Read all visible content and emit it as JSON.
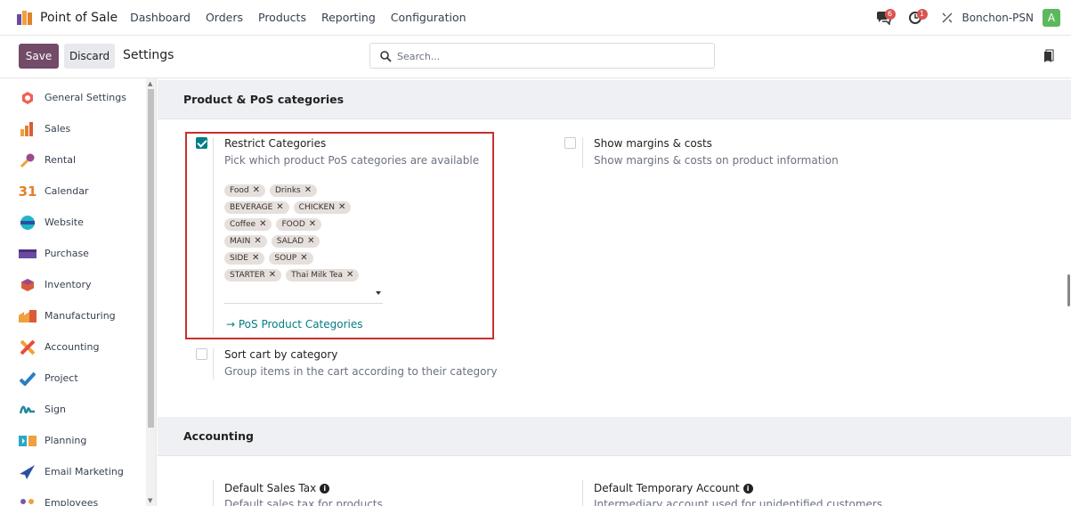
{
  "navbar": {
    "app_title": "Point of Sale",
    "menu": [
      "Dashboard",
      "Orders",
      "Products",
      "Reporting",
      "Configuration"
    ],
    "messages_count": "6",
    "activities_count": "1",
    "company": "Bonchon-PSN",
    "avatar_letter": "A"
  },
  "control": {
    "save_label": "Save",
    "discard_label": "Discard",
    "title": "Settings",
    "search_placeholder": "Search..."
  },
  "sidebar": {
    "items": [
      {
        "label": "General Settings",
        "icon": "gear-hex-icon",
        "color": "#f06050"
      },
      {
        "label": "Sales",
        "icon": "sales-icon",
        "color": "#f0a03c"
      },
      {
        "label": "Rental",
        "icon": "key-icon",
        "color": "#9c4a8a"
      },
      {
        "label": "Calendar",
        "icon": "calendar-icon",
        "color": "#e0812c"
      },
      {
        "label": "Website",
        "icon": "globe-icon",
        "color": "#21b5c7"
      },
      {
        "label": "Purchase",
        "icon": "purchase-icon",
        "color": "#6b4aa0"
      },
      {
        "label": "Inventory",
        "icon": "box-icon",
        "color": "#d95c3a"
      },
      {
        "label": "Manufacturing",
        "icon": "factory-icon",
        "color": "#f0a03c"
      },
      {
        "label": "Accounting",
        "icon": "accounting-icon",
        "color": "#e74c3c"
      },
      {
        "label": "Project",
        "icon": "check-icon",
        "color": "#2b7fc0"
      },
      {
        "label": "Sign",
        "icon": "signature-icon",
        "color": "#1f8a9a"
      },
      {
        "label": "Planning",
        "icon": "planning-icon",
        "color": "#2ba7c8"
      },
      {
        "label": "Email Marketing",
        "icon": "paper-plane-icon",
        "color": "#2b4fa0"
      },
      {
        "label": "Employees",
        "icon": "people-icon",
        "color": "#7a5aa8"
      }
    ]
  },
  "main": {
    "section1_title": "Product & PoS categories",
    "restrict": {
      "title": "Restrict Categories",
      "desc": "Pick which product PoS categories are available",
      "checked": true,
      "tag_rows": [
        [
          "Food",
          "Drinks"
        ],
        [
          "BEVERAGE",
          "CHICKEN"
        ],
        [
          "Coffee",
          "FOOD"
        ],
        [
          "MAIN",
          "SALAD"
        ],
        [
          "SIDE",
          "SOUP"
        ],
        [
          "STARTER",
          "Thai Milk Tea"
        ]
      ],
      "link": "→ PoS Product Categories"
    },
    "margins": {
      "title": "Show margins & costs",
      "desc": "Show margins & costs on product information",
      "checked": false
    },
    "sort_cart": {
      "title": "Sort cart by category",
      "desc": "Group items in the cart according to their category",
      "checked": false
    },
    "section2_title": "Accounting",
    "default_tax": {
      "title": "Default Sales Tax",
      "desc": "Default sales tax for products"
    },
    "default_temp": {
      "title": "Default Temporary Account",
      "desc": "Intermediary account used for unidentified customers."
    }
  },
  "colors": {
    "brand": "#714B67",
    "accent": "#017e84",
    "highlight_border": "#c9302c"
  }
}
